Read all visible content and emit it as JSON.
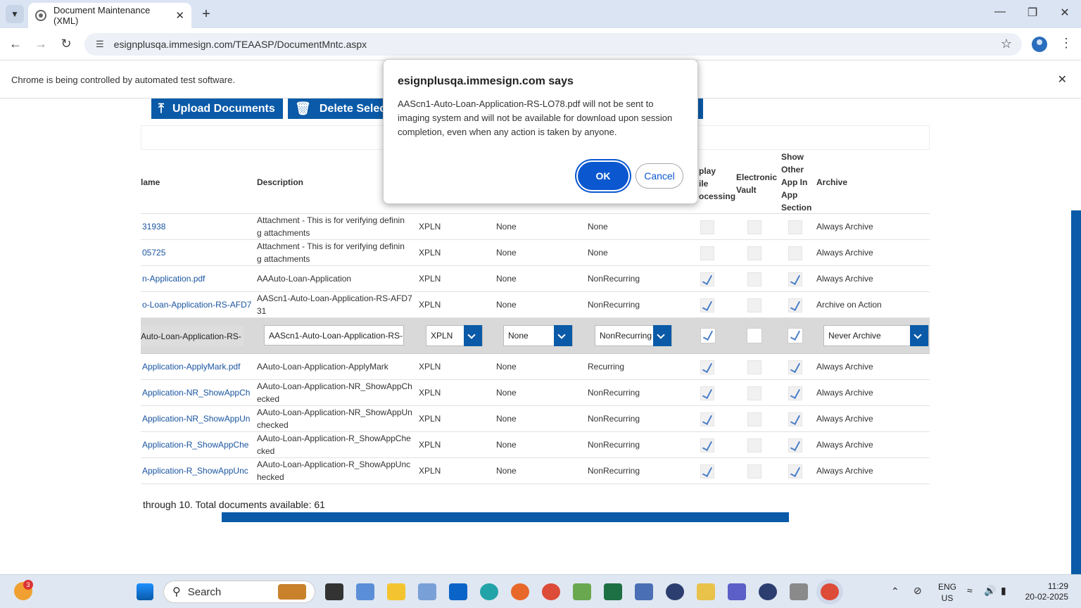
{
  "browser": {
    "tab_title": "Document Maintenance (XML)",
    "url": "esignplusqa.immesign.com/TEAASP/DocumentMntc.aspx",
    "infobar_message": "Chrome is being controlled by automated test software."
  },
  "toolbar": {
    "upload_label": "Upload Documents",
    "delete_label": "Delete Select"
  },
  "grid": {
    "headers": {
      "name": "lame",
      "description": "Description",
      "display_line1": "play",
      "display_line2": "ile",
      "display_line3": "ocessing",
      "vault_line1": "Electronic",
      "vault_line2": "Vault",
      "show_line1": "Show",
      "show_line2": "Other",
      "show_line3": "App In",
      "show_line4": "App",
      "show_line5": "Section",
      "archive": "Archive"
    },
    "rows": [
      {
        "name": "31938",
        "desc1": "Attachment - This is for verifying definin",
        "desc2": "g attachments",
        "group": "XPLN",
        "ma": "None",
        "rec": "None",
        "display": false,
        "vault": false,
        "show": false,
        "archive": "Always Archive"
      },
      {
        "name": "05725",
        "desc1": "Attachment - This is for verifying definin",
        "desc2": "g attachments",
        "group": "XPLN",
        "ma": "None",
        "rec": "None",
        "display": false,
        "vault": false,
        "show": false,
        "archive": "Always Archive"
      },
      {
        "name": "n-Application.pdf",
        "desc1": "AAAuto-Loan-Application",
        "desc2": "",
        "group": "XPLN",
        "ma": "None",
        "rec": "NonRecurring",
        "display": true,
        "vault": false,
        "show": true,
        "archive": "Always Archive"
      },
      {
        "name": "o-Loan-Application-RS-AFD7",
        "desc1": "AAScn1-Auto-Loan-Application-RS-AFD7",
        "desc2": "31",
        "group": "XPLN",
        "ma": "None",
        "rec": "NonRecurring",
        "display": true,
        "vault": false,
        "show": true,
        "archive": "Archive on Action"
      }
    ],
    "edit_row": {
      "name": "Auto-Loan-Application-RS-",
      "description_value": "AAScn1-Auto-Loan-Application-RS-",
      "group": "XPLN",
      "ma": "None",
      "rec": "NonRecurring",
      "display": true,
      "vault": false,
      "show": true,
      "archive": "Never Archive"
    },
    "rows_after": [
      {
        "name": "Application-ApplyMark.pdf",
        "desc1": "AAuto-Loan-Application-ApplyMark",
        "desc2": "",
        "group": "XPLN",
        "ma": "None",
        "rec": "Recurring",
        "display": true,
        "vault": false,
        "show": true,
        "archive": "Always Archive"
      },
      {
        "name": "Application-NR_ShowAppCh",
        "desc1": "AAuto-Loan-Application-NR_ShowAppCh",
        "desc2": "ecked",
        "group": "XPLN",
        "ma": "None",
        "rec": "NonRecurring",
        "display": true,
        "vault": false,
        "show": true,
        "archive": "Always Archive"
      },
      {
        "name": "Application-NR_ShowAppUn",
        "desc1": "AAuto-Loan-Application-NR_ShowAppUn",
        "desc2": "checked",
        "group": "XPLN",
        "ma": "None",
        "rec": "NonRecurring",
        "display": true,
        "vault": false,
        "show": true,
        "archive": "Always Archive"
      },
      {
        "name": "Application-R_ShowAppChe",
        "desc1": "AAuto-Loan-Application-R_ShowAppChe",
        "desc2": "cked",
        "group": "XPLN",
        "ma": "None",
        "rec": "NonRecurring",
        "display": true,
        "vault": false,
        "show": true,
        "archive": "Always Archive"
      },
      {
        "name": "Application-R_ShowAppUnc",
        "desc1": "AAuto-Loan-Application-R_ShowAppUnc",
        "desc2": "hecked",
        "group": "XPLN",
        "ma": "None",
        "rec": "NonRecurring",
        "display": true,
        "vault": false,
        "show": true,
        "archive": "Always Archive"
      }
    ],
    "pager_text": "through 10. Total documents available: 61"
  },
  "dialog": {
    "title": "esignplusqa.immesign.com says",
    "message": "AAScn1-Auto-Loan-Application-RS-LO78.pdf will not be sent to imaging system and will not be available for download upon session completion, even when any action is taken by anyone.",
    "ok_label": "OK",
    "cancel_label": "Cancel"
  },
  "taskbar": {
    "search_label": "Search",
    "badge_count": "3",
    "lang_line1": "ENG",
    "lang_line2": "US",
    "time": "11:29",
    "date": "20-02-2025"
  },
  "colors": {
    "accent": "#0a5aa8",
    "dialog_ok": "#0b57d0",
    "link": "#1a55a0"
  }
}
